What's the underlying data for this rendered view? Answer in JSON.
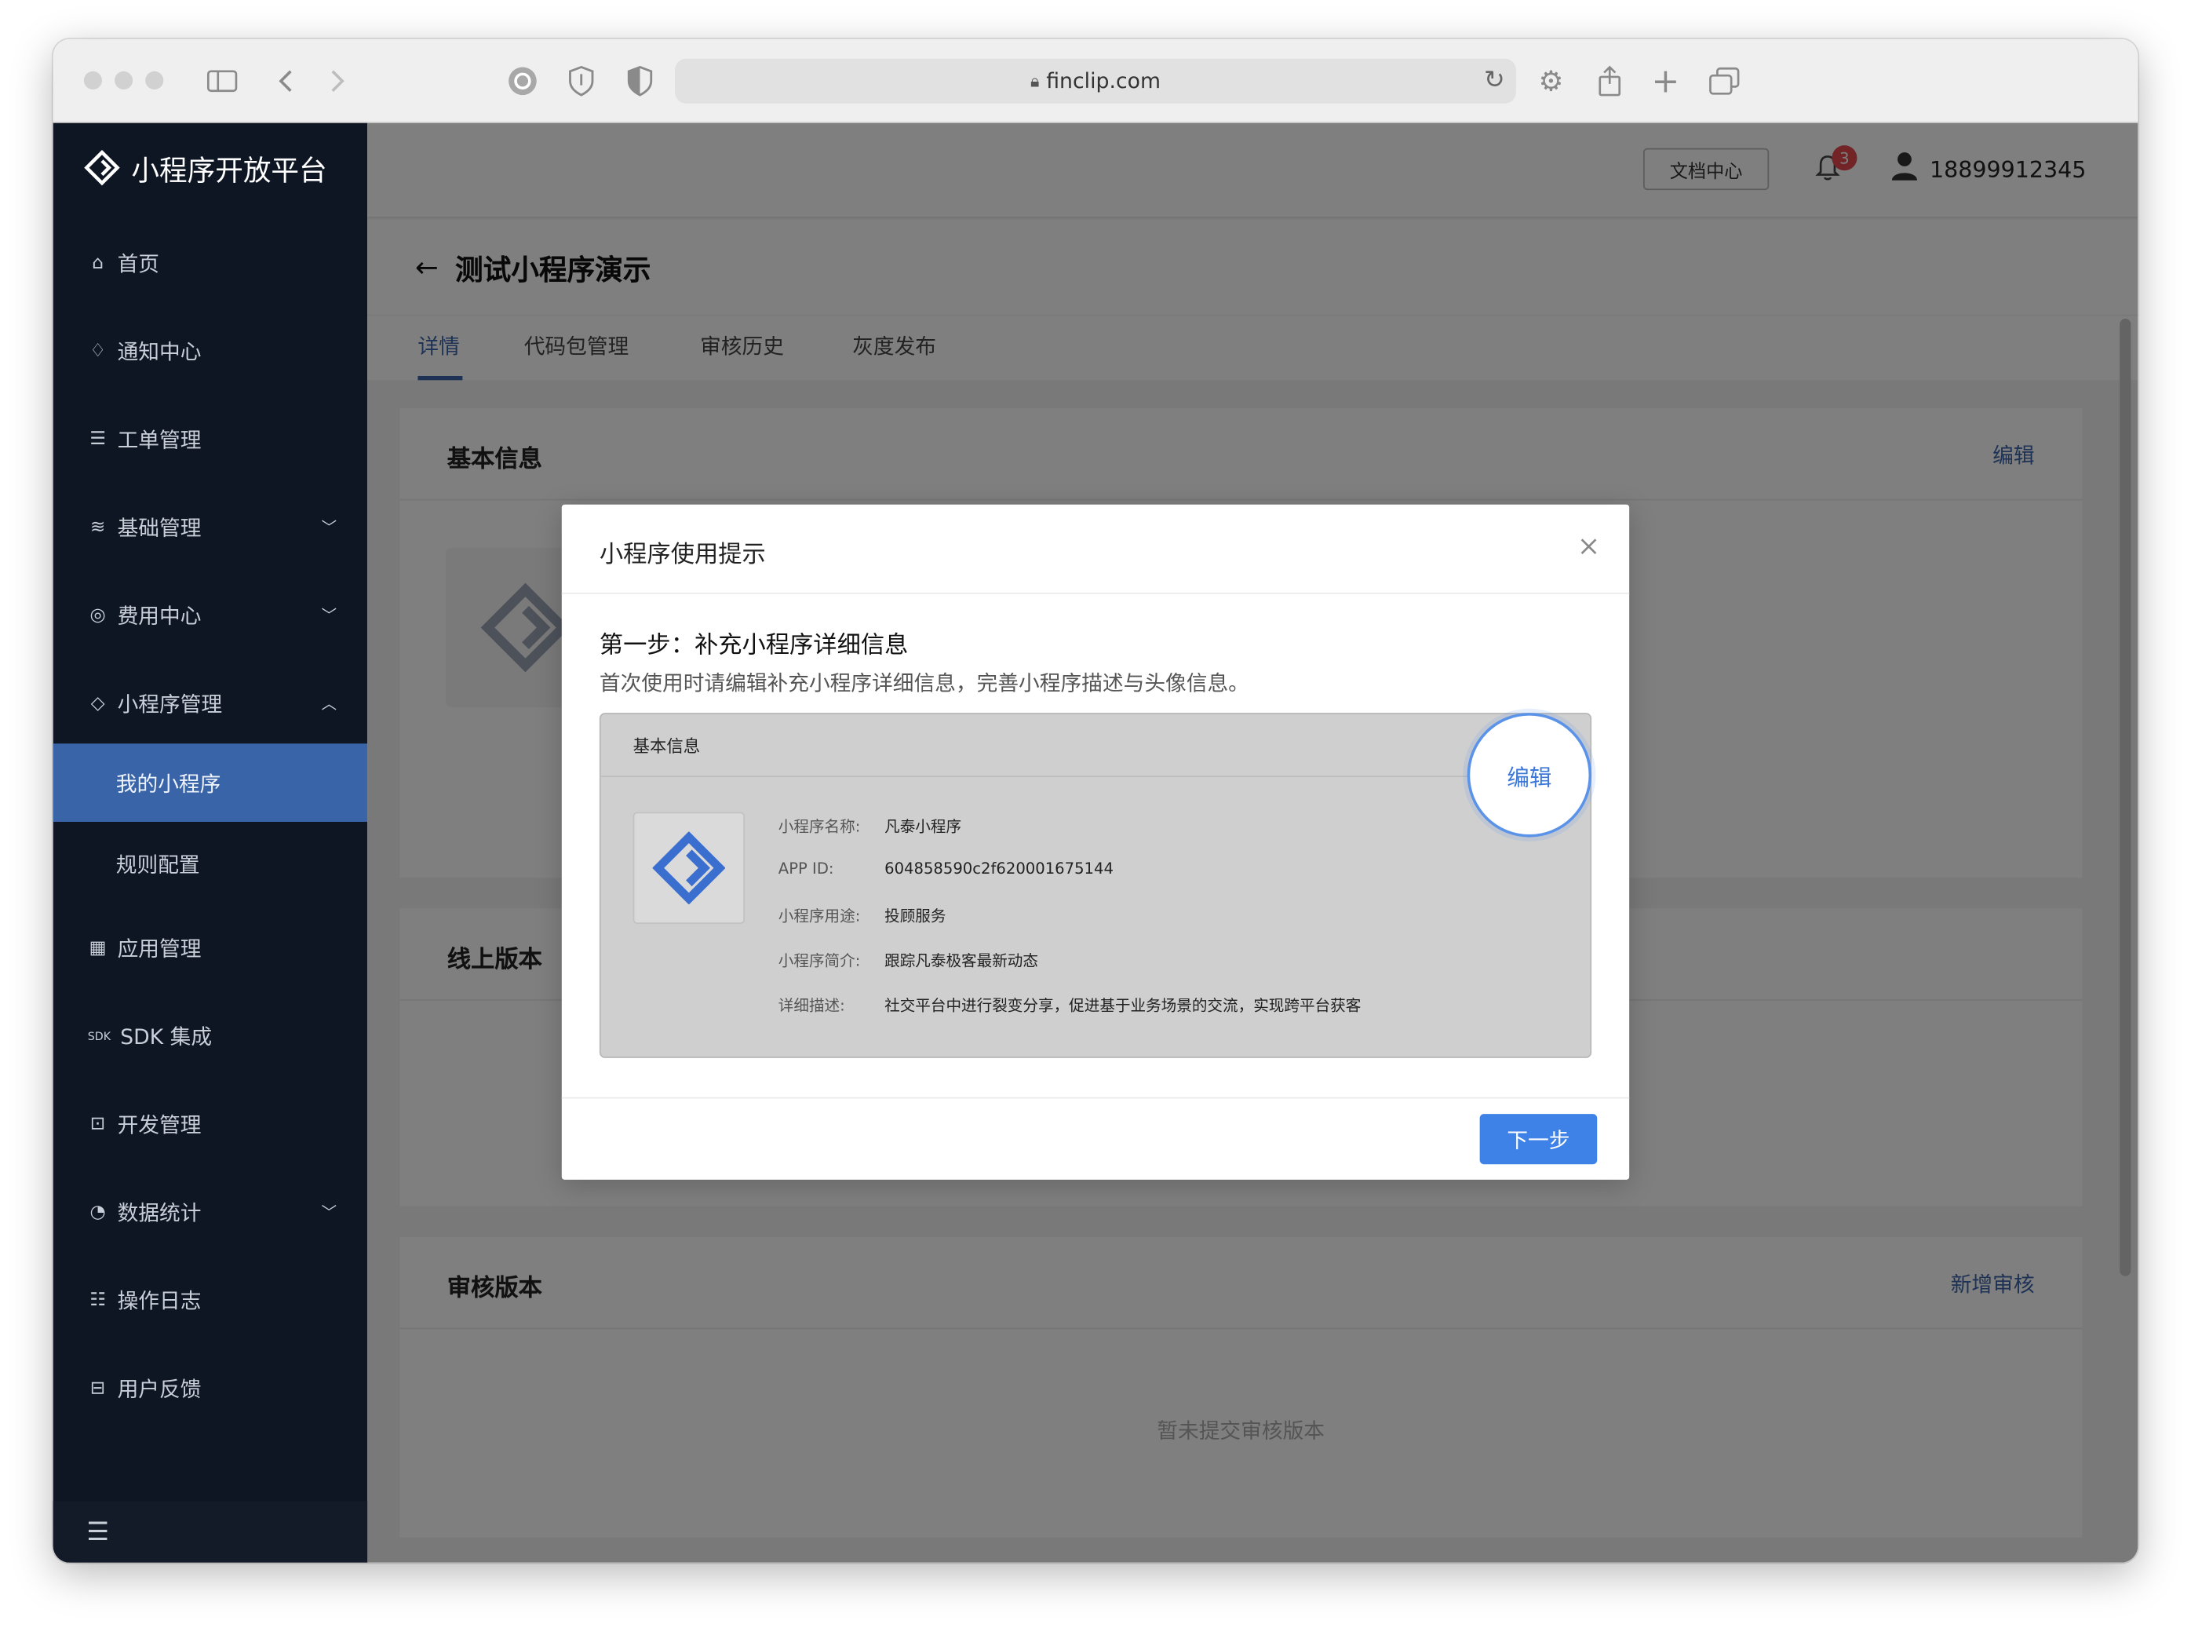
{
  "browser": {
    "url": "finclip.com"
  },
  "sidebar": {
    "brand": "小程序开放平台",
    "items": [
      {
        "icon": "home-icon",
        "glyph": "⌂",
        "label": "首页",
        "arrow": ""
      },
      {
        "icon": "bell-icon",
        "glyph": "♢",
        "label": "通知中心",
        "arrow": ""
      },
      {
        "icon": "clipboard-icon",
        "glyph": "☰",
        "label": "工单管理",
        "arrow": ""
      },
      {
        "icon": "layers-icon",
        "glyph": "≋",
        "label": "基础管理",
        "arrow": "﹀"
      },
      {
        "icon": "coin-icon",
        "glyph": "◎",
        "label": "费用中心",
        "arrow": "﹀"
      },
      {
        "icon": "diamond-icon",
        "glyph": "◇",
        "label": "小程序管理",
        "arrow": "︿"
      }
    ],
    "subitems": [
      {
        "label": "我的小程序",
        "active": true
      },
      {
        "label": "规则配置",
        "active": false
      }
    ],
    "items2": [
      {
        "icon": "grid-icon",
        "glyph": "▦",
        "label": "应用管理",
        "arrow": ""
      },
      {
        "icon": "sdk-icon",
        "glyph": "SDK",
        "label": "SDK 集成",
        "arrow": ""
      },
      {
        "icon": "code-icon",
        "glyph": "⊡",
        "label": "开发管理",
        "arrow": ""
      },
      {
        "icon": "pie-chart-icon",
        "glyph": "◔",
        "label": "数据统计",
        "arrow": "﹀"
      },
      {
        "icon": "log-icon",
        "glyph": "☷",
        "label": "操作日志",
        "arrow": ""
      },
      {
        "icon": "feedback-icon",
        "glyph": "⊟",
        "label": "用户反馈",
        "arrow": ""
      }
    ],
    "collapse_icon": "☰"
  },
  "header": {
    "doc_label": "文档中心",
    "notification_count": "3",
    "user_phone": "18899912345"
  },
  "page": {
    "title": "测试小程序演示",
    "tabs": [
      "详情",
      "代码包管理",
      "审核历史",
      "灰度发布"
    ],
    "card1_title": "基本信息",
    "card1_action": "编辑",
    "card2_title": "线上版本",
    "card3_title": "审核版本",
    "card3_action": "新增审核",
    "card3_empty": "暂未提交审核版本"
  },
  "modal": {
    "title": "小程序使用提示",
    "step_title": "第一步：补充小程序详细信息",
    "step_desc": "首次使用时请编辑补充小程序详细信息，完善小程序描述与头像信息。",
    "preview_title": "基本信息",
    "edit_label": "编辑",
    "rows": [
      {
        "label": "小程序名称:",
        "value": "凡泰小程序"
      },
      {
        "label": "APP ID:",
        "value": "604858590c2f620001675144"
      },
      {
        "label": "小程序用途:",
        "value": "投顾服务"
      },
      {
        "label": "小程序简介:",
        "value": "跟踪凡泰极客最新动态"
      },
      {
        "label": "详细描述:",
        "value": "社交平台中进行裂变分享，促进基于业务场景的交流，实现跨平台获客"
      }
    ],
    "next_label": "下一步"
  },
  "colors": {
    "sidebar_bg": "#0e1624",
    "active_item": "#3a64a8",
    "primary": "#3e82e8",
    "badge": "#e5484d"
  }
}
